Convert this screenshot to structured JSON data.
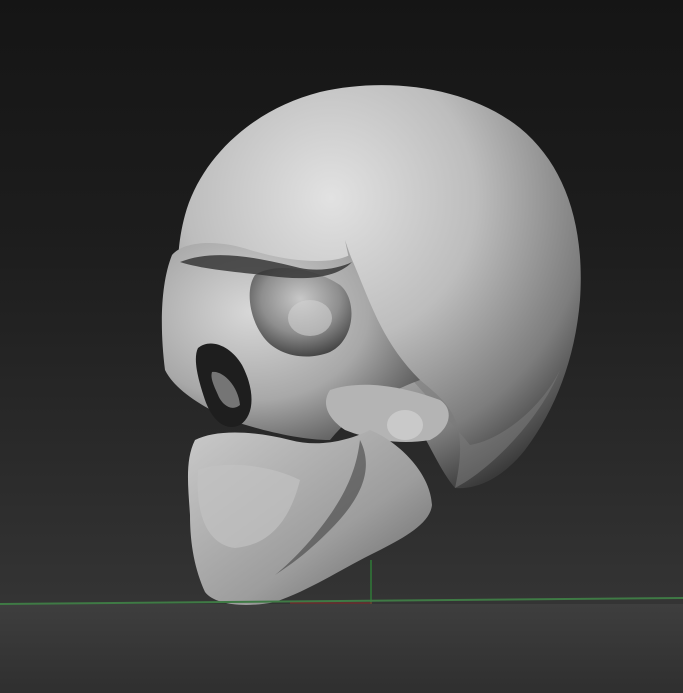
{
  "viewport": {
    "subject": "skull-mesh",
    "background_top_color": "#151515",
    "background_bottom_color": "#3a3a3a",
    "floor_color": "#3b3b3b"
  },
  "axes": {
    "x_axis_color": "#3f7a45",
    "z_axis_color": "#2e8c38",
    "origin_marker_color": "#7a2e2e"
  },
  "mesh": {
    "material_light": "#dcdcdc",
    "material_mid": "#9a9a9a",
    "material_dark": "#2a2a2a"
  }
}
